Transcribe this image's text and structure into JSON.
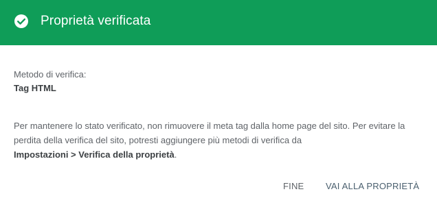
{
  "header": {
    "title": "Proprietà verificata",
    "icon": "check-circle-icon",
    "color": "#0f9d58"
  },
  "method": {
    "label": "Metodo di verifica:",
    "value": "Tag HTML"
  },
  "note": {
    "text_before": "Per mantenere lo stato verificato, non rimuovere il meta tag dalla home page del sito. Per evitare la perdita della verifica del sito, potresti aggiungere più metodi di verifica da",
    "link_path": "Impostazioni > Verifica della proprietà",
    "text_after": "."
  },
  "actions": {
    "done_label": "FINE",
    "go_label": "VAI ALLA PROPRIETÀ"
  }
}
